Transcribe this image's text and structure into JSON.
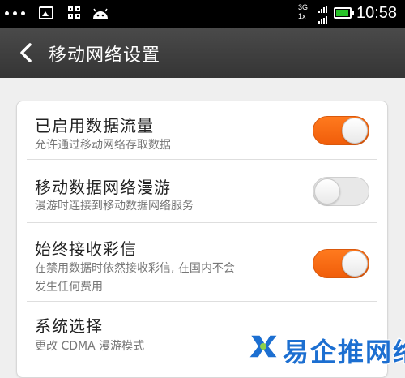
{
  "status_bar": {
    "network_top": "3G",
    "network_bottom": "1x",
    "time": "10:58",
    "battery_color": "#27c227"
  },
  "header": {
    "back_icon": "chevron-left-icon",
    "title": "移动网络设置"
  },
  "settings": [
    {
      "label": "已启用数据流量",
      "description": "允许通过移动网络存取数据",
      "toggle": true
    },
    {
      "label": "移动数据网络漫游",
      "description": "漫游时连接到移动数据网络服务",
      "toggle": false
    },
    {
      "label": "始终接收彩信",
      "description": "在禁用数据时依然接收彩信, 在国内不会发生任何费用",
      "description_line1": "在禁用数据时依然接收彩信, 在国内不会",
      "description_line2": "发生任何费用",
      "toggle": true
    },
    {
      "label": "系统选择",
      "description": "更改 CDMA 漫游模式"
    }
  ],
  "colors": {
    "toggle_on": "#f05d0a",
    "toggle_off": "#e8e8e8",
    "titlebar": "#3d3d3d",
    "watermark": "#1c6fd1"
  },
  "watermark": {
    "text": "易企推网络"
  }
}
